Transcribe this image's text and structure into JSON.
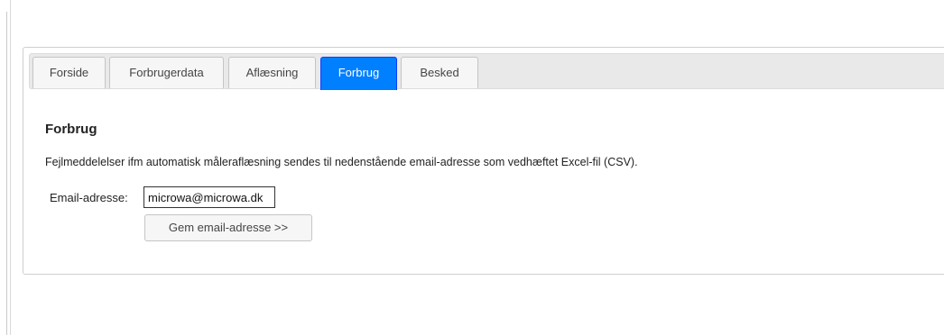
{
  "tabs": [
    {
      "label": "Forside",
      "active": false
    },
    {
      "label": "Forbrugerdata",
      "active": false
    },
    {
      "label": "Aflæsning",
      "active": false
    },
    {
      "label": "Forbrug",
      "active": true
    },
    {
      "label": "Besked",
      "active": false
    }
  ],
  "content": {
    "title": "Forbrug",
    "description": "Fejlmeddelelser ifm automatisk måleraflæsning sendes til nedenstående email-adresse som vedhæftet Excel-fil (CSV).",
    "email_label": "Email-adresse:",
    "email_value": "microwa@microwa.dk",
    "save_button_label": "Gem email-adresse >>"
  },
  "colors": {
    "active_tab": "#007fff",
    "tabbar_bg": "#e9e9e9"
  }
}
